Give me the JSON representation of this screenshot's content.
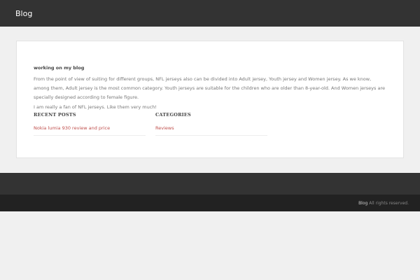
{
  "header": {
    "site_title": "Blog"
  },
  "post": {
    "title": "working on my blog",
    "paragraphs": [
      "From the point of view of suiting for different groups, NFL jerseys also can be divided into Adult jersey, Youth jersey and Women jersey. As we know, among them, Adult jersey is the most common category. Youth jerseys are suitable for the children who are older than 8-year-old. And Women jerseys are specially designed according to female figure.",
      "I am really a fan of NFL jerseys. Like them very much!"
    ]
  },
  "widgets": {
    "recent_posts": {
      "title": "RECENT POSTS",
      "items": [
        "Nokia lumia 930 review and price"
      ]
    },
    "categories": {
      "title": "CATEGORIES",
      "items": [
        "Reviews"
      ]
    }
  },
  "footer": {
    "brand": "Blog",
    "rights": "All rights reserved."
  },
  "colors": {
    "header_bg": "#333333",
    "footer_bottom_bg": "#222222",
    "link": "#c0504d"
  }
}
